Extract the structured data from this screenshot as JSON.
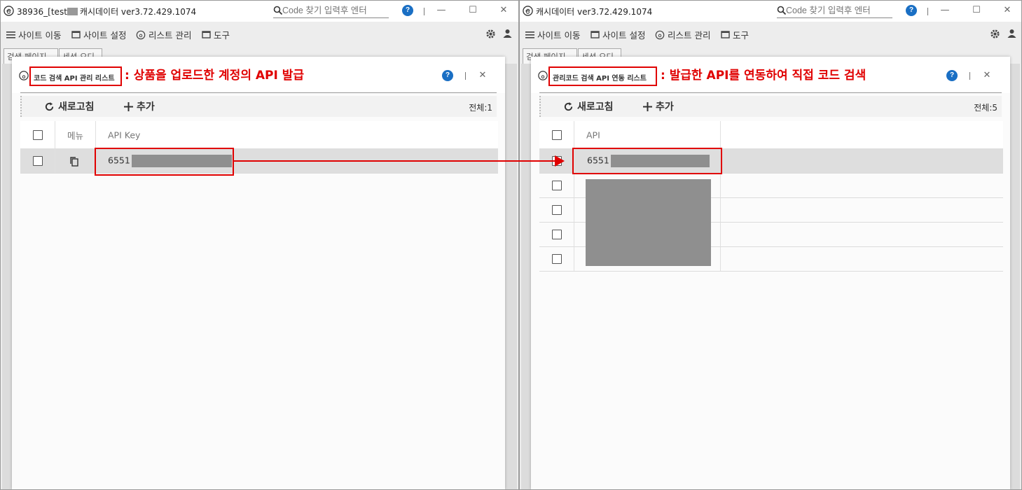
{
  "left_window": {
    "title_prefix": "38936_[test",
    "title_suffix": "캐시데이터 ver3.72.429.1074",
    "search_placeholder": "Code 찾기 입력후 엔터",
    "help": "?",
    "sep": "|",
    "menu": [
      "사이트 이동",
      "사이트 설정",
      "리스트 관리",
      "도구"
    ],
    "tabs": [
      "검색 페이지",
      "세션 오디"
    ],
    "dialog": {
      "title": "코드 검색 API 관리 리스트",
      "annotation": ": 상품을 업로드한 계정의 API 발급",
      "help": "?",
      "refresh_label": "새로고침",
      "add_label": "추가",
      "count": "전체:1",
      "columns": [
        "메뉴",
        "API Key"
      ],
      "rows": [
        {
          "api_key_visible": "6551"
        }
      ]
    }
  },
  "right_window": {
    "title": "캐시데이터 ver3.72.429.1074",
    "search_placeholder": "Code 찾기 입력후 엔터",
    "help": "?",
    "sep": "|",
    "menu": [
      "사이트 이동",
      "사이트 설정",
      "리스트 관리",
      "도구"
    ],
    "tabs": [
      "검색 페이지",
      "세션 오디"
    ],
    "dialog": {
      "title": "관리코드 검색 API 연동 리스트",
      "annotation": ": 발급한 API를 연동하여 직접 코드 검색",
      "help": "?",
      "refresh_label": "새로고침",
      "add_label": "추가",
      "count": "전체:5",
      "columns": [
        "API"
      ],
      "rows": [
        {
          "api_visible": "6551"
        },
        {},
        {},
        {},
        {}
      ]
    }
  },
  "colors": {
    "annotation_red": "#e00000",
    "help_blue": "#1a6fc4",
    "redaction_gray": "#8f8f8f"
  }
}
